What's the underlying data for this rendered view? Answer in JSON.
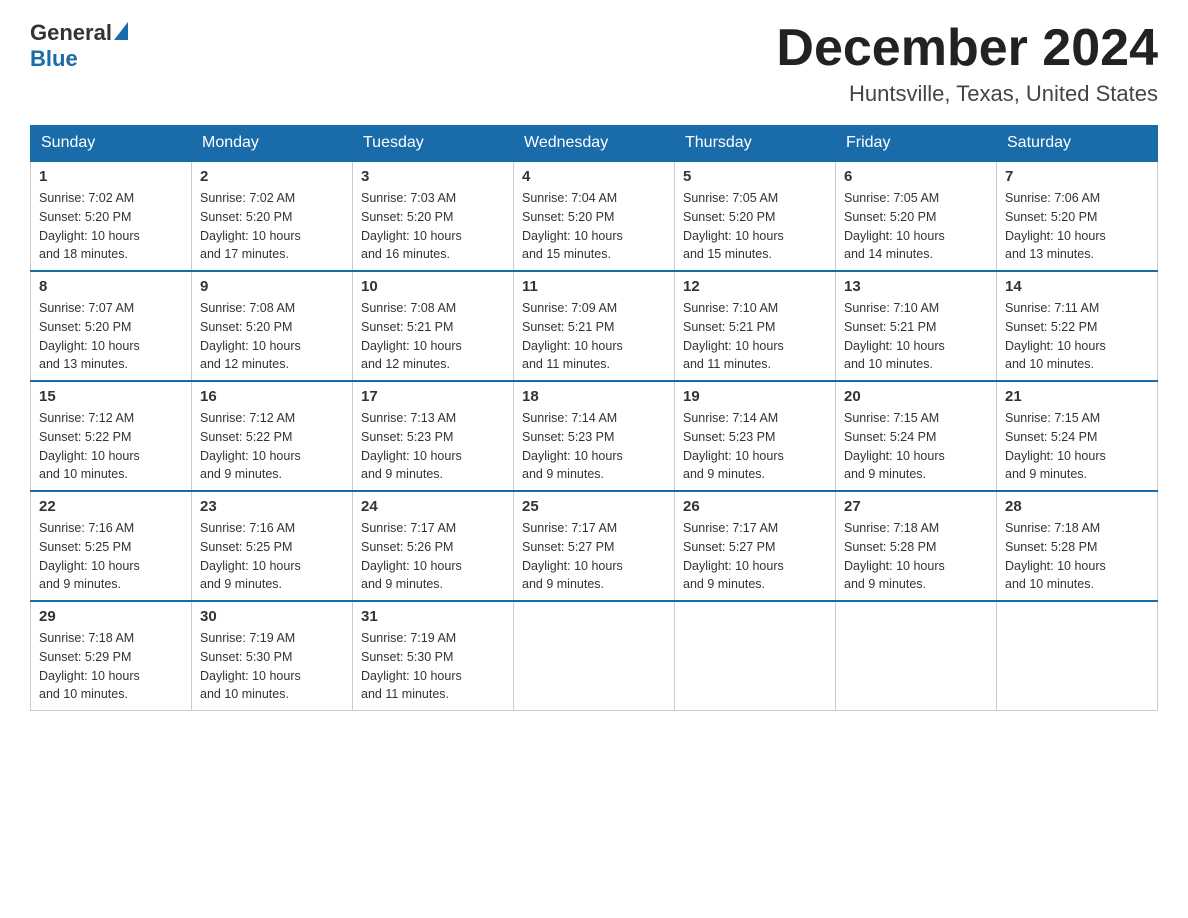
{
  "header": {
    "logo_general": "General",
    "logo_blue": "Blue",
    "month_title": "December 2024",
    "location": "Huntsville, Texas, United States"
  },
  "weekdays": [
    "Sunday",
    "Monday",
    "Tuesday",
    "Wednesday",
    "Thursday",
    "Friday",
    "Saturday"
  ],
  "weeks": [
    [
      {
        "day": "1",
        "sunrise": "7:02 AM",
        "sunset": "5:20 PM",
        "daylight": "10 hours and 18 minutes."
      },
      {
        "day": "2",
        "sunrise": "7:02 AM",
        "sunset": "5:20 PM",
        "daylight": "10 hours and 17 minutes."
      },
      {
        "day": "3",
        "sunrise": "7:03 AM",
        "sunset": "5:20 PM",
        "daylight": "10 hours and 16 minutes."
      },
      {
        "day": "4",
        "sunrise": "7:04 AM",
        "sunset": "5:20 PM",
        "daylight": "10 hours and 15 minutes."
      },
      {
        "day": "5",
        "sunrise": "7:05 AM",
        "sunset": "5:20 PM",
        "daylight": "10 hours and 15 minutes."
      },
      {
        "day": "6",
        "sunrise": "7:05 AM",
        "sunset": "5:20 PM",
        "daylight": "10 hours and 14 minutes."
      },
      {
        "day": "7",
        "sunrise": "7:06 AM",
        "sunset": "5:20 PM",
        "daylight": "10 hours and 13 minutes."
      }
    ],
    [
      {
        "day": "8",
        "sunrise": "7:07 AM",
        "sunset": "5:20 PM",
        "daylight": "10 hours and 13 minutes."
      },
      {
        "day": "9",
        "sunrise": "7:08 AM",
        "sunset": "5:20 PM",
        "daylight": "10 hours and 12 minutes."
      },
      {
        "day": "10",
        "sunrise": "7:08 AM",
        "sunset": "5:21 PM",
        "daylight": "10 hours and 12 minutes."
      },
      {
        "day": "11",
        "sunrise": "7:09 AM",
        "sunset": "5:21 PM",
        "daylight": "10 hours and 11 minutes."
      },
      {
        "day": "12",
        "sunrise": "7:10 AM",
        "sunset": "5:21 PM",
        "daylight": "10 hours and 11 minutes."
      },
      {
        "day": "13",
        "sunrise": "7:10 AM",
        "sunset": "5:21 PM",
        "daylight": "10 hours and 10 minutes."
      },
      {
        "day": "14",
        "sunrise": "7:11 AM",
        "sunset": "5:22 PM",
        "daylight": "10 hours and 10 minutes."
      }
    ],
    [
      {
        "day": "15",
        "sunrise": "7:12 AM",
        "sunset": "5:22 PM",
        "daylight": "10 hours and 10 minutes."
      },
      {
        "day": "16",
        "sunrise": "7:12 AM",
        "sunset": "5:22 PM",
        "daylight": "10 hours and 9 minutes."
      },
      {
        "day": "17",
        "sunrise": "7:13 AM",
        "sunset": "5:23 PM",
        "daylight": "10 hours and 9 minutes."
      },
      {
        "day": "18",
        "sunrise": "7:14 AM",
        "sunset": "5:23 PM",
        "daylight": "10 hours and 9 minutes."
      },
      {
        "day": "19",
        "sunrise": "7:14 AM",
        "sunset": "5:23 PM",
        "daylight": "10 hours and 9 minutes."
      },
      {
        "day": "20",
        "sunrise": "7:15 AM",
        "sunset": "5:24 PM",
        "daylight": "10 hours and 9 minutes."
      },
      {
        "day": "21",
        "sunrise": "7:15 AM",
        "sunset": "5:24 PM",
        "daylight": "10 hours and 9 minutes."
      }
    ],
    [
      {
        "day": "22",
        "sunrise": "7:16 AM",
        "sunset": "5:25 PM",
        "daylight": "10 hours and 9 minutes."
      },
      {
        "day": "23",
        "sunrise": "7:16 AM",
        "sunset": "5:25 PM",
        "daylight": "10 hours and 9 minutes."
      },
      {
        "day": "24",
        "sunrise": "7:17 AM",
        "sunset": "5:26 PM",
        "daylight": "10 hours and 9 minutes."
      },
      {
        "day": "25",
        "sunrise": "7:17 AM",
        "sunset": "5:27 PM",
        "daylight": "10 hours and 9 minutes."
      },
      {
        "day": "26",
        "sunrise": "7:17 AM",
        "sunset": "5:27 PM",
        "daylight": "10 hours and 9 minutes."
      },
      {
        "day": "27",
        "sunrise": "7:18 AM",
        "sunset": "5:28 PM",
        "daylight": "10 hours and 9 minutes."
      },
      {
        "day": "28",
        "sunrise": "7:18 AM",
        "sunset": "5:28 PM",
        "daylight": "10 hours and 10 minutes."
      }
    ],
    [
      {
        "day": "29",
        "sunrise": "7:18 AM",
        "sunset": "5:29 PM",
        "daylight": "10 hours and 10 minutes."
      },
      {
        "day": "30",
        "sunrise": "7:19 AM",
        "sunset": "5:30 PM",
        "daylight": "10 hours and 10 minutes."
      },
      {
        "day": "31",
        "sunrise": "7:19 AM",
        "sunset": "5:30 PM",
        "daylight": "10 hours and 11 minutes."
      },
      null,
      null,
      null,
      null
    ]
  ],
  "labels": {
    "sunrise": "Sunrise:",
    "sunset": "Sunset:",
    "daylight": "Daylight:"
  }
}
